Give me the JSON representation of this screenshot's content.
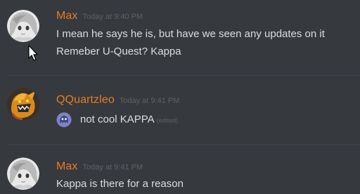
{
  "messages": [
    {
      "username": "Max",
      "timestamp": "Today at 9:40 PM",
      "lines": [
        "I mean he says he is, but have we seen any updates on it",
        "Remeber U-Quest? Kappa"
      ]
    },
    {
      "username": "QQuartzleo",
      "timestamp": "Today at 9:41 PM",
      "text": "not cool KAPPA",
      "edited": "(edited)",
      "emote": "blue-ghost-emote"
    },
    {
      "username": "Max",
      "timestamp": "Today at 9:41 PM",
      "lines": [
        "Kappa is there for a reason"
      ]
    }
  ],
  "colors": {
    "background": "#36393e",
    "username": "#e67e22",
    "text": "#dcddde",
    "timestamp": "#5d6066"
  }
}
